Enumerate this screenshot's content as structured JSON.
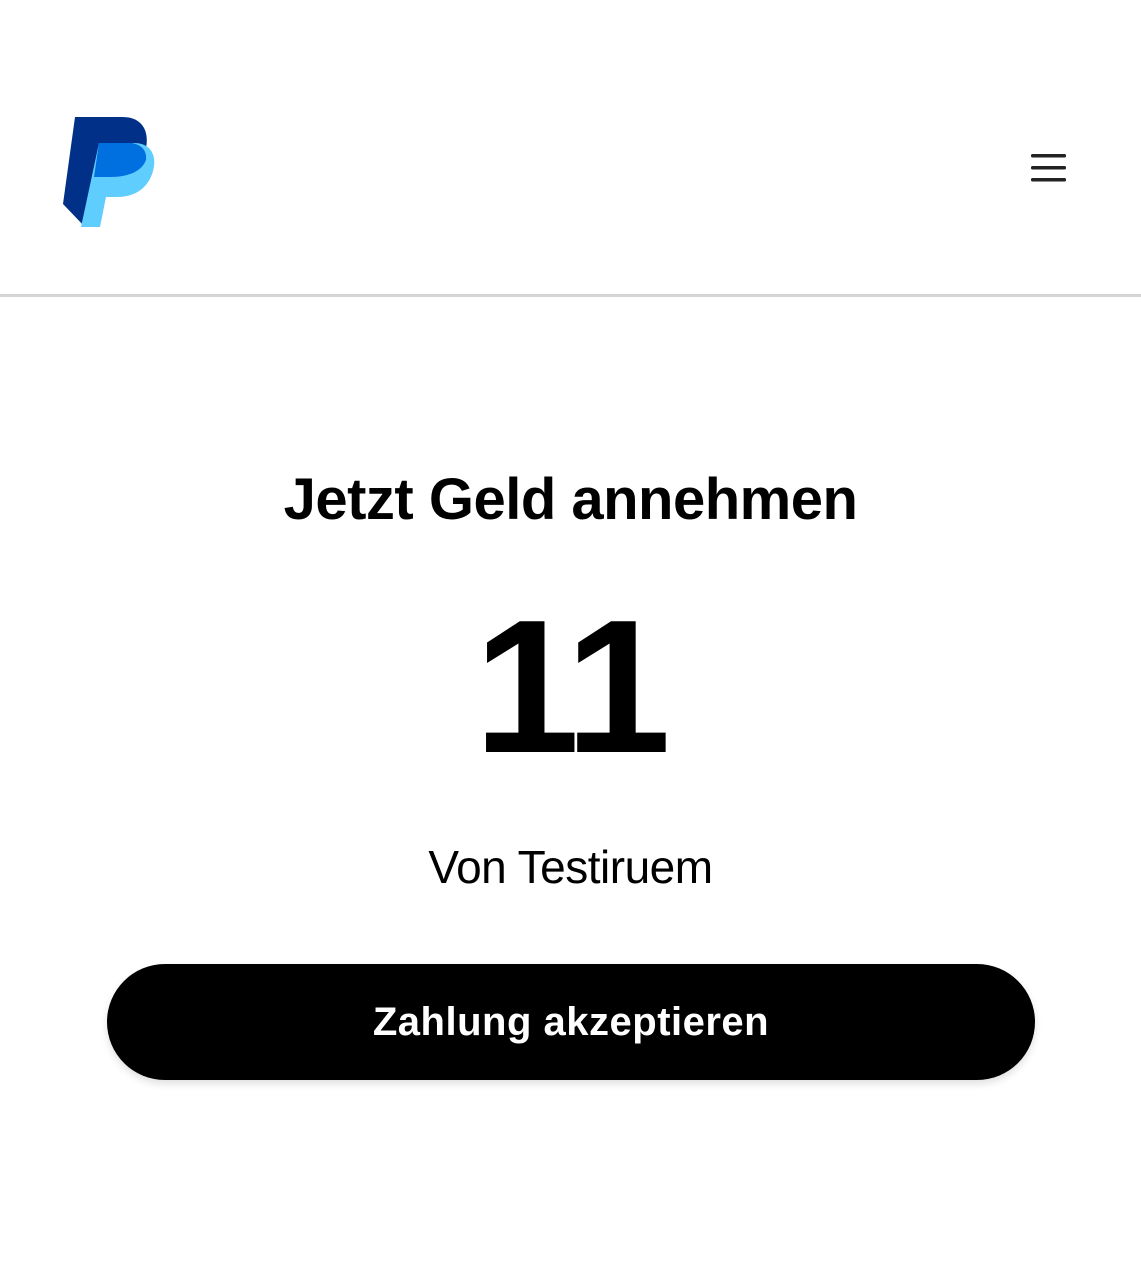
{
  "header": {
    "logo_icon": "paypal-logo-icon",
    "menu_icon": "hamburger-menu-icon"
  },
  "main": {
    "heading": "Jetzt Geld annehmen",
    "amount": "11",
    "sender": "Von Testiruem",
    "accept_button_label": "Zahlung akzeptieren"
  },
  "colors": {
    "logo_dark_blue": "#003087",
    "logo_mid_blue": "#0070e0",
    "logo_light_blue": "#60cdff",
    "button_background": "#000000",
    "button_text": "#ffffff",
    "divider": "#d4d4d4"
  }
}
